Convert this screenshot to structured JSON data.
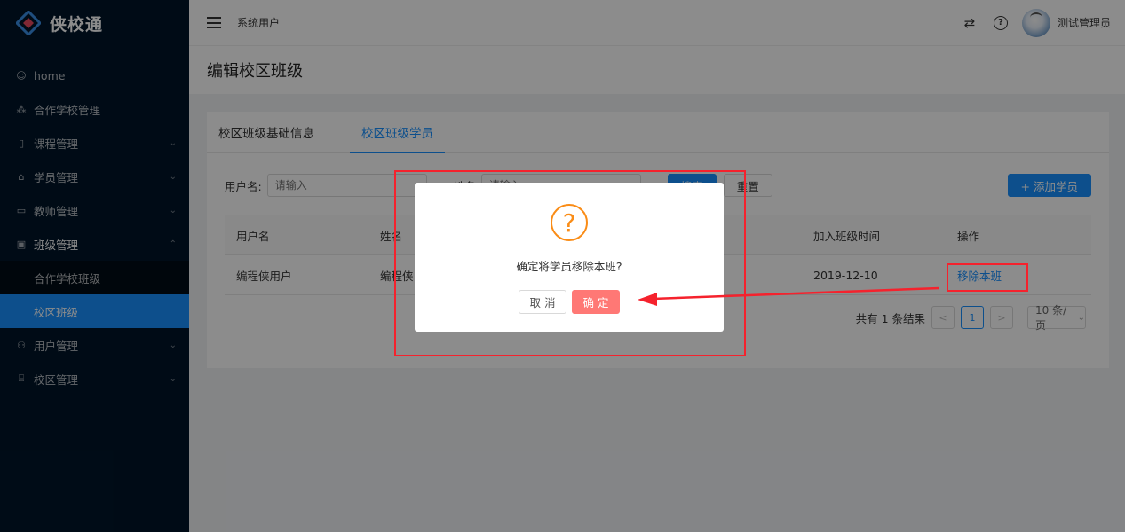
{
  "app": {
    "name": "侠校通"
  },
  "sidebar": {
    "items": [
      {
        "label": "home",
        "icon": "smile-icon"
      },
      {
        "label": "合作学校管理",
        "icon": "cluster-icon"
      },
      {
        "label": "课程管理",
        "icon": "book-icon",
        "arrow": "⌄"
      },
      {
        "label": "学员管理",
        "icon": "team-icon",
        "arrow": "⌄"
      },
      {
        "label": "教师管理",
        "icon": "idcard-icon",
        "arrow": "⌄"
      },
      {
        "label": "班级管理",
        "icon": "class-icon",
        "arrow": "⌃"
      },
      {
        "label": "用户管理",
        "icon": "user-group-icon",
        "arrow": "⌄"
      },
      {
        "label": "校区管理",
        "icon": "campus-icon",
        "arrow": "⌄"
      }
    ],
    "sub_items": [
      {
        "label": "合作学校班级"
      },
      {
        "label": "校区班级"
      }
    ]
  },
  "header": {
    "breadcrumb": "系统用户",
    "user_name": "测试管理员"
  },
  "page": {
    "title": "编辑校区班级"
  },
  "tabs": [
    {
      "label": "校区班级基础信息"
    },
    {
      "label": "校区班级学员"
    }
  ],
  "search": {
    "username_label": "用户名:",
    "username_placeholder": "请输入",
    "name_label": "姓名",
    "name_placeholder": "请输入",
    "search_button": "搜索",
    "reset_button": "重置",
    "add_button": "+ 添加学员"
  },
  "table": {
    "headers": [
      "用户名",
      "姓名",
      "",
      "加入班级时间",
      "操作"
    ],
    "rows": [
      {
        "username": "编程侠用户",
        "name": "编程侠",
        "joined": "2019-12-10",
        "action": "移除本班"
      }
    ]
  },
  "pagination": {
    "total_text": "共有 1 条结果",
    "prev": "<",
    "current": "1",
    "next": ">",
    "page_size": "10 条/页"
  },
  "modal": {
    "icon": "?",
    "message": "确定将学员移除本班?",
    "cancel": "取 消",
    "ok": "确 定"
  },
  "colors": {
    "sidebar_bg": "#001529",
    "primary": "#1890ff",
    "warning": "#fa8c16",
    "danger_button": "#ff7875",
    "annotation": "#f5222d"
  }
}
